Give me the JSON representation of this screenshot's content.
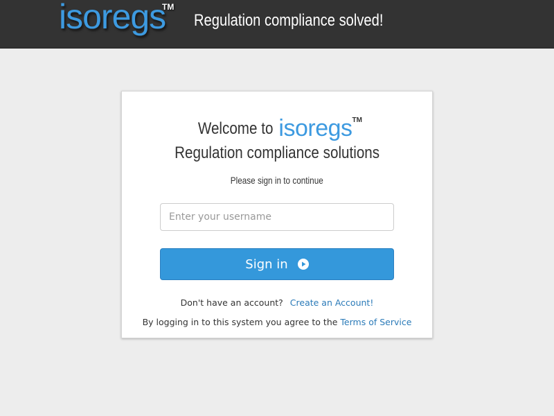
{
  "header": {
    "brand": "isoregs",
    "trademark": "TM",
    "tagline": "Regulation compliance solved!"
  },
  "login": {
    "welcome": "Welcome to",
    "brand": "isoregs",
    "trademark": "TM",
    "subtitle": "Regulation compliance solutions",
    "hint": "Please sign in to continue",
    "username_placeholder": "Enter your username",
    "username_value": "",
    "signin_label": "Sign in",
    "no_account_text": "Don't have an account?",
    "create_account_link": "Create an Account!",
    "tos_text": "By logging in to this system you agree to the",
    "tos_link": "Terms of Service"
  },
  "colors": {
    "brand_blue": "#3d9ae0",
    "button_blue": "#3498db",
    "link_blue": "#2a7ab8",
    "header_bg": "#333333",
    "page_bg": "#ededed"
  },
  "icons": {
    "signin_button_icon": "play-circle-icon"
  }
}
